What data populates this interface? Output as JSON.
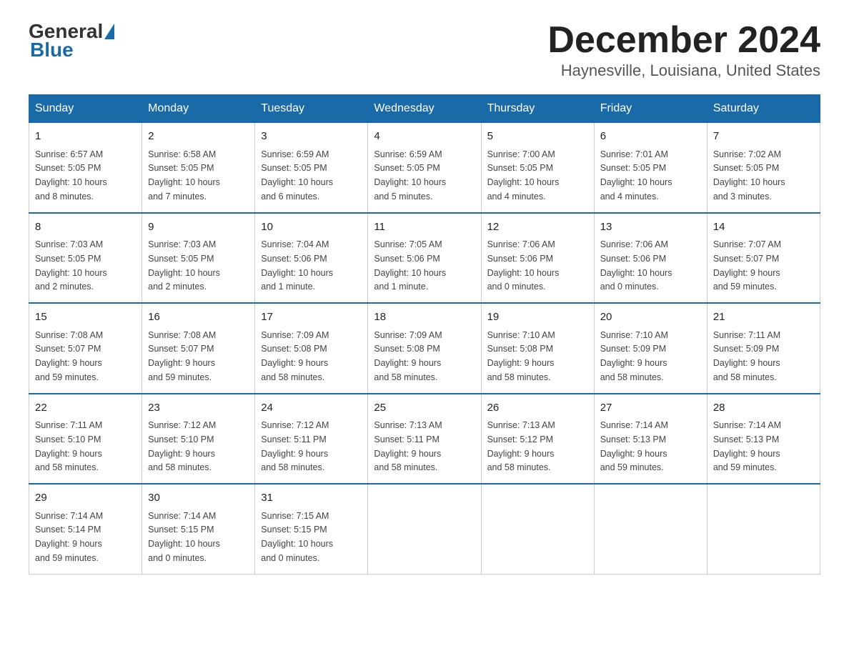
{
  "header": {
    "logo_text_general": "General",
    "logo_text_blue": "Blue",
    "month_title": "December 2024",
    "location": "Haynesville, Louisiana, United States"
  },
  "days_of_week": [
    "Sunday",
    "Monday",
    "Tuesday",
    "Wednesday",
    "Thursday",
    "Friday",
    "Saturday"
  ],
  "weeks": [
    [
      {
        "day": "1",
        "info": "Sunrise: 6:57 AM\nSunset: 5:05 PM\nDaylight: 10 hours\nand 8 minutes."
      },
      {
        "day": "2",
        "info": "Sunrise: 6:58 AM\nSunset: 5:05 PM\nDaylight: 10 hours\nand 7 minutes."
      },
      {
        "day": "3",
        "info": "Sunrise: 6:59 AM\nSunset: 5:05 PM\nDaylight: 10 hours\nand 6 minutes."
      },
      {
        "day": "4",
        "info": "Sunrise: 6:59 AM\nSunset: 5:05 PM\nDaylight: 10 hours\nand 5 minutes."
      },
      {
        "day": "5",
        "info": "Sunrise: 7:00 AM\nSunset: 5:05 PM\nDaylight: 10 hours\nand 4 minutes."
      },
      {
        "day": "6",
        "info": "Sunrise: 7:01 AM\nSunset: 5:05 PM\nDaylight: 10 hours\nand 4 minutes."
      },
      {
        "day": "7",
        "info": "Sunrise: 7:02 AM\nSunset: 5:05 PM\nDaylight: 10 hours\nand 3 minutes."
      }
    ],
    [
      {
        "day": "8",
        "info": "Sunrise: 7:03 AM\nSunset: 5:05 PM\nDaylight: 10 hours\nand 2 minutes."
      },
      {
        "day": "9",
        "info": "Sunrise: 7:03 AM\nSunset: 5:05 PM\nDaylight: 10 hours\nand 2 minutes."
      },
      {
        "day": "10",
        "info": "Sunrise: 7:04 AM\nSunset: 5:06 PM\nDaylight: 10 hours\nand 1 minute."
      },
      {
        "day": "11",
        "info": "Sunrise: 7:05 AM\nSunset: 5:06 PM\nDaylight: 10 hours\nand 1 minute."
      },
      {
        "day": "12",
        "info": "Sunrise: 7:06 AM\nSunset: 5:06 PM\nDaylight: 10 hours\nand 0 minutes."
      },
      {
        "day": "13",
        "info": "Sunrise: 7:06 AM\nSunset: 5:06 PM\nDaylight: 10 hours\nand 0 minutes."
      },
      {
        "day": "14",
        "info": "Sunrise: 7:07 AM\nSunset: 5:07 PM\nDaylight: 9 hours\nand 59 minutes."
      }
    ],
    [
      {
        "day": "15",
        "info": "Sunrise: 7:08 AM\nSunset: 5:07 PM\nDaylight: 9 hours\nand 59 minutes."
      },
      {
        "day": "16",
        "info": "Sunrise: 7:08 AM\nSunset: 5:07 PM\nDaylight: 9 hours\nand 59 minutes."
      },
      {
        "day": "17",
        "info": "Sunrise: 7:09 AM\nSunset: 5:08 PM\nDaylight: 9 hours\nand 58 minutes."
      },
      {
        "day": "18",
        "info": "Sunrise: 7:09 AM\nSunset: 5:08 PM\nDaylight: 9 hours\nand 58 minutes."
      },
      {
        "day": "19",
        "info": "Sunrise: 7:10 AM\nSunset: 5:08 PM\nDaylight: 9 hours\nand 58 minutes."
      },
      {
        "day": "20",
        "info": "Sunrise: 7:10 AM\nSunset: 5:09 PM\nDaylight: 9 hours\nand 58 minutes."
      },
      {
        "day": "21",
        "info": "Sunrise: 7:11 AM\nSunset: 5:09 PM\nDaylight: 9 hours\nand 58 minutes."
      }
    ],
    [
      {
        "day": "22",
        "info": "Sunrise: 7:11 AM\nSunset: 5:10 PM\nDaylight: 9 hours\nand 58 minutes."
      },
      {
        "day": "23",
        "info": "Sunrise: 7:12 AM\nSunset: 5:10 PM\nDaylight: 9 hours\nand 58 minutes."
      },
      {
        "day": "24",
        "info": "Sunrise: 7:12 AM\nSunset: 5:11 PM\nDaylight: 9 hours\nand 58 minutes."
      },
      {
        "day": "25",
        "info": "Sunrise: 7:13 AM\nSunset: 5:11 PM\nDaylight: 9 hours\nand 58 minutes."
      },
      {
        "day": "26",
        "info": "Sunrise: 7:13 AM\nSunset: 5:12 PM\nDaylight: 9 hours\nand 58 minutes."
      },
      {
        "day": "27",
        "info": "Sunrise: 7:14 AM\nSunset: 5:13 PM\nDaylight: 9 hours\nand 59 minutes."
      },
      {
        "day": "28",
        "info": "Sunrise: 7:14 AM\nSunset: 5:13 PM\nDaylight: 9 hours\nand 59 minutes."
      }
    ],
    [
      {
        "day": "29",
        "info": "Sunrise: 7:14 AM\nSunset: 5:14 PM\nDaylight: 9 hours\nand 59 minutes."
      },
      {
        "day": "30",
        "info": "Sunrise: 7:14 AM\nSunset: 5:15 PM\nDaylight: 10 hours\nand 0 minutes."
      },
      {
        "day": "31",
        "info": "Sunrise: 7:15 AM\nSunset: 5:15 PM\nDaylight: 10 hours\nand 0 minutes."
      },
      {
        "day": "",
        "info": ""
      },
      {
        "day": "",
        "info": ""
      },
      {
        "day": "",
        "info": ""
      },
      {
        "day": "",
        "info": ""
      }
    ]
  ]
}
